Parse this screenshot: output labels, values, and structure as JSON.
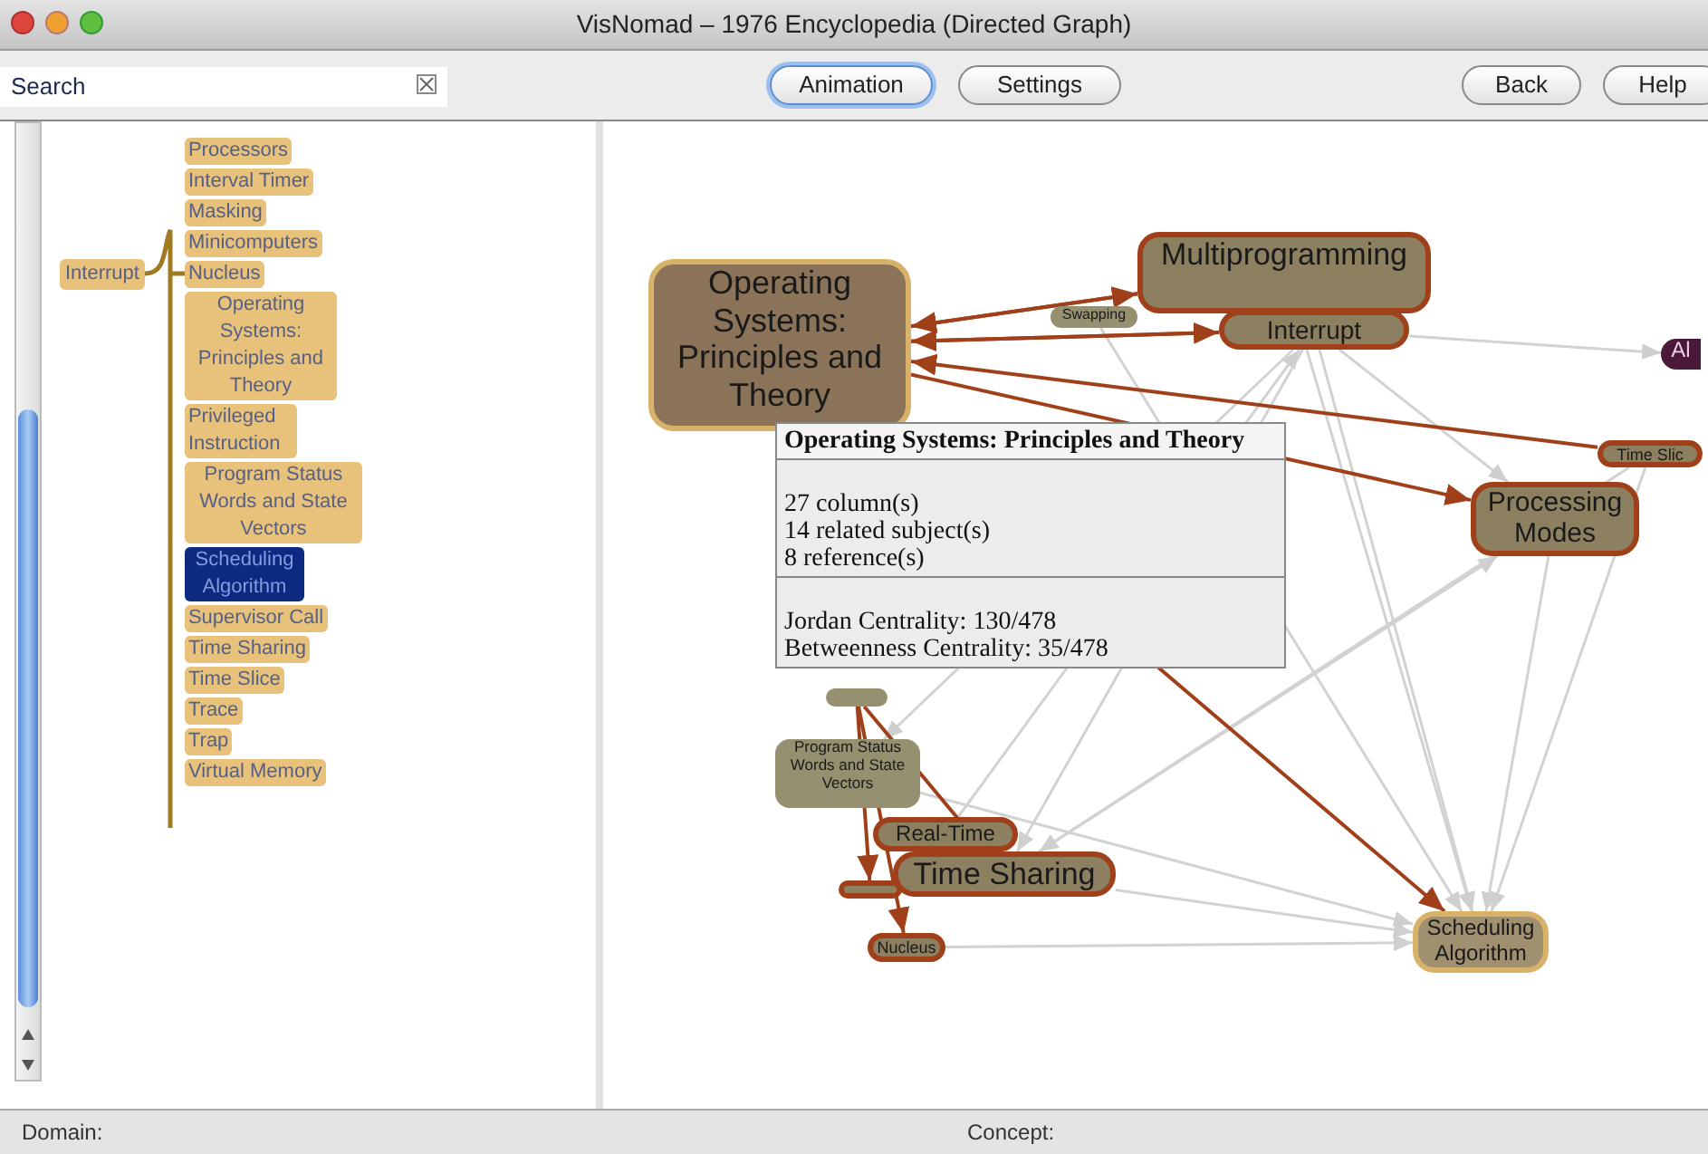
{
  "window": {
    "title": "VisNomad – 1976 Encyclopedia (Directed Graph)"
  },
  "search": {
    "placeholder": "Search"
  },
  "toolbar": {
    "center_buttons": [
      {
        "label": "Animation",
        "selected": true
      },
      {
        "label": "Settings",
        "selected": false
      }
    ],
    "right_buttons": [
      {
        "label": "Back"
      },
      {
        "label": "Help"
      }
    ]
  },
  "tree": {
    "root": {
      "label": "Interrupt",
      "children": [
        {
          "label": "Processors",
          "selected": false
        },
        {
          "label": "Interval Timer",
          "selected": false
        },
        {
          "label": "Masking",
          "selected": false
        },
        {
          "label": "Minicomputers",
          "selected": false
        },
        {
          "label": "Nucleus",
          "selected": false
        },
        {
          "label": "Operating Systems: Principles and Theory",
          "selected": false
        },
        {
          "label": "Privileged Instruction",
          "selected": false
        },
        {
          "label": "Program Status Words and State Vectors",
          "selected": false
        },
        {
          "label": "Scheduling Algorithm",
          "selected": true
        },
        {
          "label": "Supervisor Call",
          "selected": false
        },
        {
          "label": "Time Sharing",
          "selected": false
        },
        {
          "label": "Time Slice",
          "selected": false
        },
        {
          "label": "Trace",
          "selected": false
        },
        {
          "label": "Trap",
          "selected": false
        },
        {
          "label": "Virtual Memory",
          "selected": false
        }
      ]
    }
  },
  "graph": {
    "nodes": [
      {
        "label": "Operating Systems: Principles and Theory",
        "kind": "focus"
      },
      {
        "label": "Multiprogramming",
        "kind": "linked"
      },
      {
        "label": "Swapping",
        "kind": "plain"
      },
      {
        "label": "Interrupt",
        "kind": "linked"
      },
      {
        "label": "Al",
        "kind": "dark"
      },
      {
        "label": "Time Slic",
        "kind": "linked"
      },
      {
        "label": "Processing Modes",
        "kind": "linked"
      },
      {
        "kind": "plain"
      },
      {
        "label": "Program Status Words and State Vectors",
        "kind": "plain"
      },
      {
        "label": "Real-Time",
        "kind": "linked"
      },
      {
        "label": "Time Sharing",
        "kind": "linked"
      },
      {
        "kind": "linked"
      },
      {
        "label": "Nucleus",
        "kind": "linked"
      },
      {
        "label": "Scheduling Algorithm",
        "kind": "highlight"
      }
    ],
    "tooltip": {
      "title": "Operating Systems: Principles and Theory",
      "stats": [
        "27 column(s)",
        "14 related subject(s)",
        "8 reference(s)"
      ],
      "centrality": [
        "Jordan Centrality: 130/478",
        "Betweenness Centrality: 35/478"
      ]
    }
  },
  "status_bar": {
    "domain": "Domain:",
    "concept": "Concept:"
  }
}
